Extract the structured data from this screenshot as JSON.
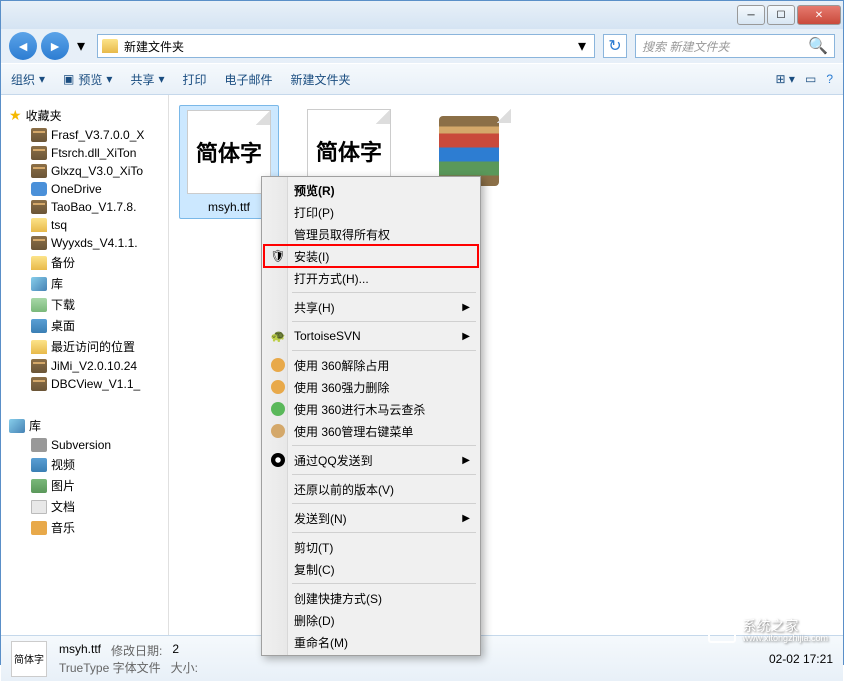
{
  "window": {
    "title": ""
  },
  "navigation": {
    "folder_name": "新建文件夹",
    "search_placeholder": "搜索 新建文件夹"
  },
  "toolbar": {
    "organize": "组织",
    "preview": "预览",
    "share": "共享",
    "print": "打印",
    "email": "电子邮件",
    "new_folder": "新建文件夹"
  },
  "sidebar": {
    "favorites": {
      "label": "收藏夹",
      "items": [
        "Frasf_V3.7.0.0_X",
        "Ftsrch.dll_XiTon",
        "Glxzq_V3.0_XiTo",
        "OneDrive",
        "TaoBao_V1.7.8.",
        "tsq",
        "Wyyxds_V4.1.1.",
        "备份",
        "库",
        "下载",
        "桌面",
        "最近访问的位置",
        "JiMi_V2.0.10.24",
        "DBCView_V1.1_"
      ]
    },
    "libraries": {
      "label": "库",
      "items": [
        "Subversion",
        "视频",
        "图片",
        "文档",
        "音乐"
      ]
    }
  },
  "files": [
    {
      "name": "msyh.ttf",
      "preview": "简体字",
      "selected": true
    },
    {
      "name": "",
      "preview": "简体字",
      "selected": false
    },
    {
      "name": "",
      "type": "archive",
      "selected": false
    }
  ],
  "context_menu": {
    "items": [
      {
        "label": "预览(R)",
        "type": "item",
        "bold": true
      },
      {
        "label": "打印(P)",
        "type": "item"
      },
      {
        "label": "管理员取得所有权",
        "type": "item"
      },
      {
        "label": "安装(I)",
        "type": "item",
        "icon": "shield",
        "highlighted": true
      },
      {
        "label": "打开方式(H)...",
        "type": "item"
      },
      {
        "type": "separator"
      },
      {
        "label": "共享(H)",
        "type": "submenu"
      },
      {
        "type": "separator"
      },
      {
        "label": "TortoiseSVN",
        "type": "submenu",
        "icon": "turtle"
      },
      {
        "type": "separator"
      },
      {
        "label": "使用 360解除占用",
        "type": "item",
        "icon": "360orange"
      },
      {
        "label": "使用 360强力删除",
        "type": "item",
        "icon": "360orange"
      },
      {
        "label": "使用 360进行木马云查杀",
        "type": "item",
        "icon": "360green"
      },
      {
        "label": "使用 360管理右键菜单",
        "type": "item",
        "icon": "360gold"
      },
      {
        "type": "separator"
      },
      {
        "label": "通过QQ发送到",
        "type": "submenu",
        "icon": "qq"
      },
      {
        "type": "separator"
      },
      {
        "label": "还原以前的版本(V)",
        "type": "item"
      },
      {
        "type": "separator"
      },
      {
        "label": "发送到(N)",
        "type": "submenu"
      },
      {
        "type": "separator"
      },
      {
        "label": "剪切(T)",
        "type": "item"
      },
      {
        "label": "复制(C)",
        "type": "item"
      },
      {
        "type": "separator"
      },
      {
        "label": "创建快捷方式(S)",
        "type": "item"
      },
      {
        "label": "删除(D)",
        "type": "item"
      },
      {
        "label": "重命名(M)",
        "type": "item"
      }
    ]
  },
  "statusbar": {
    "filename": "msyh.ttf",
    "type_label": "TrueType 字体文件",
    "date_label": "修改日期:",
    "date_value": "2",
    "size_label": "大小:",
    "right_text": "02-02 17:21"
  },
  "watermark": {
    "line1": "系统之家",
    "line2": "www.xitongzhijia.com"
  }
}
